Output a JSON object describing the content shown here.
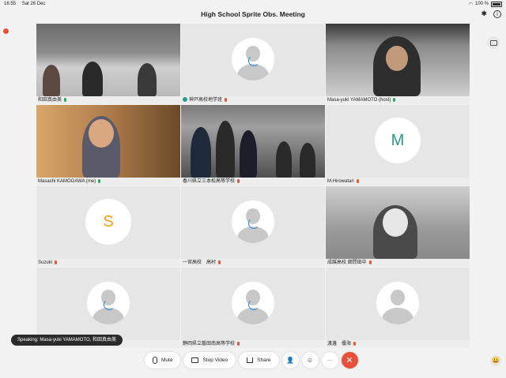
{
  "status": {
    "time": "16:55",
    "date": "Sat 26 Dec",
    "battery": "100 %"
  },
  "meeting": {
    "title": "High School Sprite Obs. Meeting"
  },
  "participants": [
    {
      "name": "和田真由美",
      "mic": "on",
      "kind": "video"
    },
    {
      "name": "神戸高校地学班",
      "mic": "off",
      "kind": "avatar"
    },
    {
      "name": "Masa-yuki YAMAMOTO (host)",
      "mic": "on",
      "kind": "video"
    },
    {
      "name": "Masashi KAMOGAWA (me)",
      "mic": "on",
      "kind": "video"
    },
    {
      "name": "香川県立三本松高等学校",
      "mic": "off",
      "kind": "video"
    },
    {
      "name": "M.Hirowatari",
      "mic": "off",
      "kind": "letter",
      "letter": "M"
    },
    {
      "name": "Suzuki",
      "mic": "off",
      "kind": "letter",
      "letter": "S"
    },
    {
      "name": "一宮高校　高村",
      "mic": "off",
      "kind": "avatar"
    },
    {
      "name": "成蹊高校 鋼問田中",
      "mic": "off",
      "kind": "video"
    },
    {
      "name": "",
      "mic": "",
      "kind": "avatar"
    },
    {
      "name": "静岡県立磐田南高等学校",
      "mic": "off",
      "kind": "avatar"
    },
    {
      "name": "渡邊　優海",
      "mic": "off",
      "kind": "avatar"
    }
  ],
  "speaking": "Speaking: Masa-yuki YAMAMOTO, 和田真由美",
  "controls": {
    "mute": "Mute",
    "stop_video": "Stop Video",
    "share": "Share",
    "more": "···",
    "leave": "✕"
  },
  "corner_emoji": "😀"
}
